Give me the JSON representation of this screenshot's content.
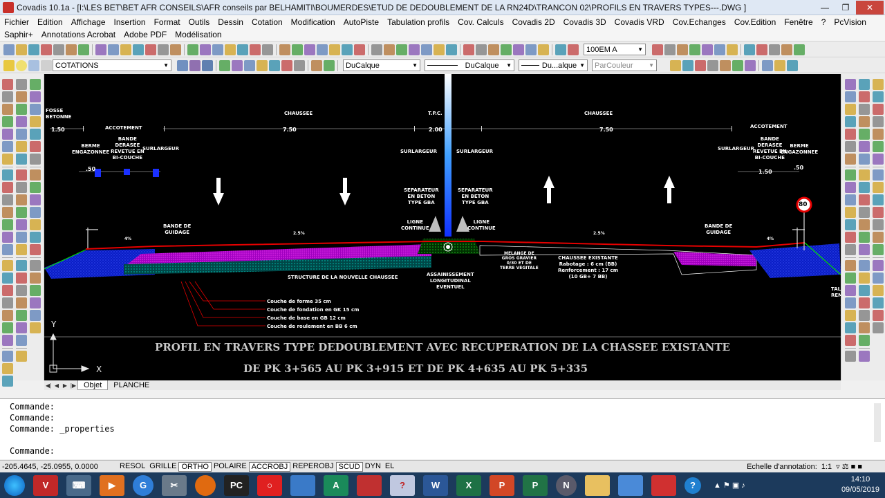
{
  "window": {
    "title": "Covadis 10.1a - [I:\\LES BET\\BET AFR CONSEILS\\AFR conseils par BELHAMITI\\BOUMERDES\\ETUD DE DEDOUBLEMENT DE LA RN24D\\TRANCON 02\\PROFILS EN TRAVERS TYPES---.DWG ]"
  },
  "menu_row1": [
    "Fichier",
    "Edition",
    "Affichage",
    "Insertion",
    "Format",
    "Outils",
    "Dessin",
    "Cotation",
    "Modification",
    "AutoPiste",
    "Tabulation profils",
    "Cov. Calculs",
    "Covadis 2D",
    "Covadis 3D",
    "Covadis VRD",
    "Cov.Echanges",
    "Cov.Edition",
    "Fenêtre",
    "?",
    "PcVision"
  ],
  "menu_row2": [
    "Saphir+",
    "Annotations Acrobat",
    "Adobe PDF",
    "Modélisation"
  ],
  "toolbar": {
    "scale_combo": "100EM A",
    "layer_combo": "COTATIONS",
    "color_combo": "DuCalque",
    "linetype_combo": "DuCalque",
    "lineweight_combo": "Du...alque",
    "plotstyle_combo": "ParCouleur"
  },
  "drawing": {
    "left_labels": {
      "fosse": "FOSSE\nBETONNE",
      "accotement": "ACCOTEMENT",
      "berme": "BERME\nENGAZONNEE",
      "bande": "BANDE\nDERASEE\nREVETUE EN\nBI-COUCHE",
      "surlargeur": "SURLARGEUR"
    },
    "top_labels": {
      "chaussee_left": "CHAUSSEE",
      "tpc": "T.P.C.",
      "chaussee_right": "CHAUSSEE",
      "accotement_right": "ACCOTEMENT",
      "surlargeur_l": "SURLARGEUR",
      "surlargeur_r": "SURLARGEUR"
    },
    "right_labels": {
      "surlargeur": "SURLARGEUR",
      "bande": "BANDE\nDERASEE\nREVETUE EN\nBI-COUCHE",
      "berme": "BERME\nENGAZONNEE"
    },
    "dims": {
      "d150_left": "1.50",
      "d750_left": "7.50",
      "d200": "2.00",
      "d750_right": "7.50",
      "d050_left": ".50",
      "d150_right": "1.50",
      "d050_right": ".50"
    },
    "center_labels": {
      "sep_left": "SEPARATEUR\nEN BETON\nTYPE GBA",
      "sep_right": "SEPARATEUR\nEN BETON\nTYPE GBA",
      "ligne_left": "LIGNE\nCONTINUE",
      "ligne_right": "LIGNE\nCONTINUE",
      "assainissement": "ASSAINISSEMENT\nLONGITUDINAL\nEVENTUEL",
      "melange": "MELANGE DE\nGROS GRAVIER\n0/30 ET DE\nTERRE VEGITALE"
    },
    "bande_guidage_left": "BANDE DE\nGUIDAGE",
    "bande_guidage_right": "BANDE DE\nGUIDAGE",
    "structure": "STRUCTURE DE LA NOUVELLE CHAUSSEE",
    "existante": "CHAUSSEE EXISTANTE\nRabotage : 6 cm (BB)\nRenforcement : 17 cm\n(10 GB+ 7 BB)",
    "slopes": {
      "s1": "4%",
      "s2": "2.5%",
      "s3": "2.5%",
      "s4": "4%"
    },
    "sign": "80",
    "cut_label": "TAL\nREM",
    "layers": [
      "Couche de forme 35 cm",
      "Couche de fondation en GK 15 cm",
      "Couche de base en GB 12 cm",
      "Couche de roulement en BB 6 cm"
    ],
    "title_line1": "PROFIL EN TRAVERS TYPE DEDOUBLEMENT AVEC RECUPERATION DE LA CHASSEE EXISTANTE",
    "title_line2": "DE PK 3+565 AU PK 3+915   ET   DE PK 4+635 AU PK 5+335",
    "ucs_x": "X",
    "ucs_y": "Y"
  },
  "tabs": [
    "Objet",
    "PLANCHE"
  ],
  "command_lines": [
    "Commande:",
    "Commande:",
    "Commande: _properties"
  ],
  "command_prompt": "Commande:",
  "status": {
    "coords": "-205.4645, -25.0955, 0.0000",
    "toggles": [
      "RESOL",
      "GRILLE",
      "ORTHO",
      "POLAIRE",
      "ACCROBJ",
      "REPEROBJ",
      "SCUD",
      "DYN",
      "EL"
    ],
    "annotation_label": "Echelle d'annotation:",
    "annotation_value": "1:1"
  },
  "clock": {
    "time": "14:10",
    "date": "09/05/2019"
  },
  "colors": {
    "accent_red": "#e60000",
    "magenta": "#e000ff",
    "blue_fill": "#0a1cc8",
    "cyan": "#00d8d8",
    "green": "#00e000"
  }
}
